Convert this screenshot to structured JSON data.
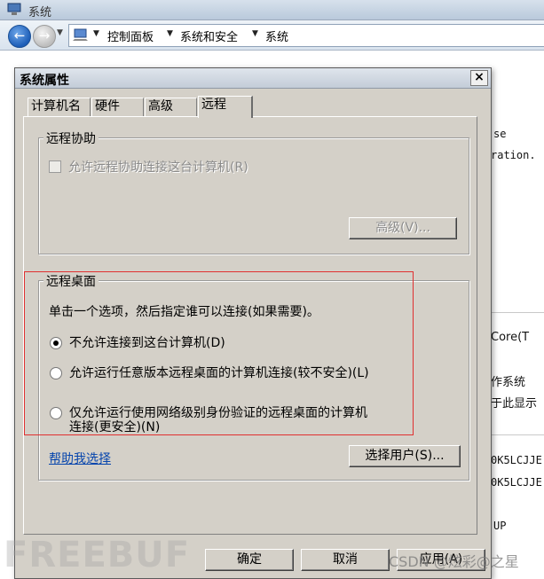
{
  "window": {
    "title": "系统",
    "breadcrumb": [
      "控制面板",
      "系统和安全",
      "系统"
    ]
  },
  "background_fragments": {
    "f1": "se",
    "f2": "ration.",
    "f3": "Core(T",
    "f4": "作系统",
    "f5": "于此显示",
    "f6": "0K5LCJJE",
    "f7": "0K5LCJJE",
    "f8": "UP"
  },
  "dialog": {
    "title": "系统属性",
    "close": "×",
    "tabs": [
      "计算机名",
      "硬件",
      "高级",
      "远程"
    ],
    "active_tab": "远程",
    "remote_assistance": {
      "legend": "远程协助",
      "checkbox_label": "允许远程协助连接这台计算机(R)",
      "checkbox_checked": false,
      "advanced_button": "高级(V)..."
    },
    "remote_desktop": {
      "legend": "远程桌面",
      "instruction": "单击一个选项，然后指定谁可以连接(如果需要)。",
      "options": [
        {
          "label": "不允许连接到这台计算机(D)",
          "checked": true
        },
        {
          "label": "允许运行任意版本远程桌面的计算机连接(较不安全)(L)",
          "checked": false
        },
        {
          "label": "仅允许运行使用网络级别身份验证的远程桌面的计算机",
          "label2": "连接(更安全)(N)",
          "checked": false
        }
      ],
      "help_link": "帮助我选择",
      "select_users_button": "选择用户(S)..."
    },
    "buttons": {
      "ok": "确定",
      "cancel": "取消",
      "apply": "应用(A)"
    }
  },
  "watermarks": {
    "left": "FREEBUF",
    "right": "CSDN @炫彩@之星"
  },
  "colors": {
    "highlight_box": "#e03030",
    "dialog_bg": "#d4d0c8",
    "link": "#0645ad"
  }
}
